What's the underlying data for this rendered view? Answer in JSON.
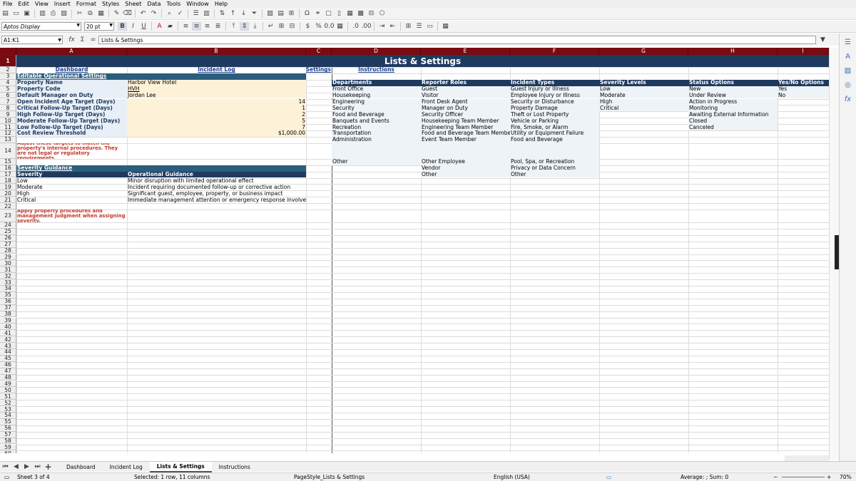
{
  "menu": [
    "File",
    "Edit",
    "View",
    "Insert",
    "Format",
    "Styles",
    "Sheet",
    "Data",
    "Tools",
    "Window",
    "Help"
  ],
  "font_name": "Aptos Display",
  "font_size": "20 pt",
  "name_box": "A1:K1",
  "formula": "Lists & Settings",
  "columns": [
    {
      "label": "A"
    },
    {
      "label": "B"
    },
    {
      "label": "C"
    },
    {
      "label": "D"
    },
    {
      "label": "E"
    },
    {
      "label": "F"
    },
    {
      "label": "G"
    },
    {
      "label": "H"
    },
    {
      "label": "I"
    }
  ],
  "sheet": {
    "title": "Lists & Settings",
    "nav": {
      "dashboard": "Dashboard",
      "incident_log": "Incident Log",
      "lists": "Lists & Settings",
      "instructions": "Instructions"
    },
    "editable_header": "Editable Operational Settings",
    "settings": [
      {
        "label": "Property Name",
        "value": "Harbor View Hotel"
      },
      {
        "label": "Property Code",
        "value": "HVH"
      },
      {
        "label": "Default Manager on Duty",
        "value": "Jordan Lee"
      },
      {
        "label": "Open Incident Age Target (Days)",
        "value": "14"
      },
      {
        "label": "Critical Follow-Up Target (Days)",
        "value": "1"
      },
      {
        "label": "High Follow-Up Target (Days)",
        "value": "2"
      },
      {
        "label": "Moderate Follow-Up Target (Days)",
        "value": "5"
      },
      {
        "label": "Low Follow-Up Target (Days)",
        "value": "7"
      },
      {
        "label": "Cost Review Threshold",
        "value": "$1,000.00"
      }
    ],
    "note1": "Adjust these targets to match the property's internal procedures. They are not legal or regulatory requirements.",
    "severity_header": "Severity Guidance",
    "sev_col1": "Severity",
    "sev_col2": "Operational Guidance",
    "guidance": [
      {
        "sev": "Low",
        "text": "Minor disruption with limited operational effect"
      },
      {
        "sev": "Moderate",
        "text": "Incident requiring documented follow-up or corrective action"
      },
      {
        "sev": "High",
        "text": "Significant guest, employee, property, or business impact"
      },
      {
        "sev": "Critical",
        "text": "Immediate management attention or emergency response involved"
      }
    ],
    "note2": "Apply property procedures and management judgment when assigning severity.",
    "lists_headers": [
      "Departments",
      "Reporter Roles",
      "Incident Types",
      "Severity Levels",
      "Status Options",
      "Yes/No Options"
    ],
    "departments": [
      "Front Office",
      "Housekeeping",
      "Engineering",
      "Security",
      "Food and Beverage",
      "Banquets and Events",
      "Recreation",
      "Transportation",
      "Administration",
      "",
      "Other"
    ],
    "reporter_roles": [
      "Guest",
      "Visitor",
      "Front Desk Agent",
      "Manager on Duty",
      "Security Officer",
      "Housekeeping Team Member",
      "Engineering Team Member",
      "Food and Beverage Team Member",
      "Event Team Member",
      "",
      "Other Employee",
      "Vendor",
      "Other"
    ],
    "incident_types": [
      "Guest Injury or Illness",
      "Employee Injury or Illness",
      "Security or Disturbance",
      "Property Damage",
      "Theft or Lost Property",
      "Vehicle or Parking",
      "Fire, Smoke, or Alarm",
      "Utility or Equipment Failure",
      "Food and Beverage",
      "",
      "Pool, Spa, or Recreation",
      "Privacy or Data Concern",
      "Other"
    ],
    "severity_levels": [
      "Low",
      "Moderate",
      "High",
      "Critical"
    ],
    "status_options": [
      "New",
      "Under Review",
      "Action in Progress",
      "Monitoring",
      "Awaiting External Information",
      "Closed",
      "Canceled"
    ],
    "yes_no": [
      "Yes",
      "No"
    ]
  },
  "tabs": [
    "Dashboard",
    "Incident Log",
    "Lists & Settings",
    "Instructions"
  ],
  "status": {
    "sheet": "Sheet 3 of 4",
    "selected": "Selected: 1 row, 11 columns",
    "page_style": "PageStyle_Lists & Settings",
    "language": "English (USA)",
    "summary": "Average: ; Sum: 0",
    "zoom": "70%"
  }
}
